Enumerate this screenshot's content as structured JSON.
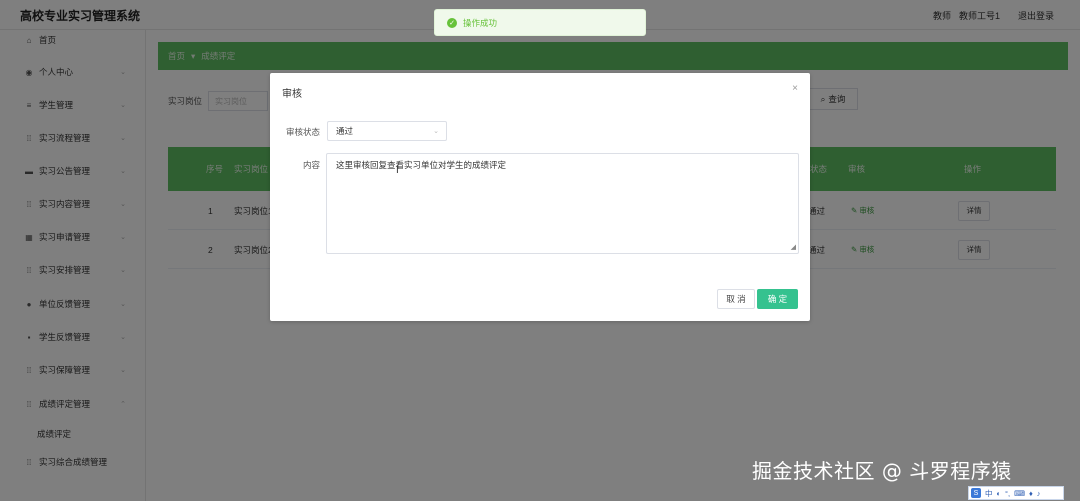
{
  "header": {
    "title": "高校专业实习管理系统",
    "role": "教师",
    "account": "教师工号1",
    "logout": "退出登录"
  },
  "sidebar": {
    "items": [
      {
        "label": "首页",
        "icon": "home-icon",
        "glyph": "⌂"
      },
      {
        "label": "个人中心",
        "icon": "user-icon",
        "glyph": "◉"
      },
      {
        "label": "学生管理",
        "icon": "list-icon",
        "glyph": "≡"
      },
      {
        "label": "实习流程管理",
        "icon": "grid-icon",
        "glyph": "⁞⁞"
      },
      {
        "label": "实习公告管理",
        "icon": "notice-icon",
        "glyph": "▬"
      },
      {
        "label": "实习内容管理",
        "icon": "grid-icon",
        "glyph": "⁞⁞"
      },
      {
        "label": "实习申请管理",
        "icon": "form-icon",
        "glyph": "▦"
      },
      {
        "label": "实习安排管理",
        "icon": "grid-icon",
        "glyph": "⁞⁞"
      },
      {
        "label": "单位反馈管理",
        "icon": "location-icon",
        "glyph": "●"
      },
      {
        "label": "学生反馈管理",
        "icon": "comment-icon",
        "glyph": "▪"
      },
      {
        "label": "实习保障管理",
        "icon": "grid-icon",
        "glyph": "⁞⁞"
      },
      {
        "label": "成绩评定管理",
        "icon": "grid-icon",
        "glyph": "⁞⁞"
      }
    ],
    "sub_item": "成绩评定",
    "last_item": {
      "label": "实习综合成绩管理",
      "icon": "grid-icon",
      "glyph": "⁞⁞"
    }
  },
  "main": {
    "breadcrumb": [
      "首页",
      "▾",
      "成绩评定"
    ],
    "search_label": "实习岗位",
    "search_placeholder": "实习岗位",
    "query_button": "查询",
    "table": {
      "headers": [
        "",
        "序号",
        "实习岗位"
      ],
      "status_header": "状态",
      "audit_header": "审核",
      "action_header": "操作",
      "rows": [
        {
          "index": "1",
          "post": "实习岗位1",
          "status": "通过",
          "audit": "审核",
          "detail": "详情"
        },
        {
          "index": "2",
          "post": "实习岗位2",
          "status": "通过",
          "audit": "审核",
          "detail": "详情"
        }
      ]
    }
  },
  "toast": {
    "text": "操作成功"
  },
  "dialog": {
    "title": "审核",
    "status_label": "审核状态",
    "status_value": "通过",
    "content_label": "内容",
    "content_value": "这里审核回复查看实习单位对学生的成绩评定",
    "cancel": "取 消",
    "confirm": "确 定"
  },
  "watermark": "掘金技术社区 @ 斗罗程序猿",
  "ime": {
    "logo": "S",
    "items": [
      "中",
      "◐",
      "°,",
      "⌨",
      "♦",
      "♪"
    ]
  },
  "colors": {
    "primary_green": "#5fbf63",
    "confirm_button": "#35c28f",
    "toast_green": "#67c23a"
  }
}
